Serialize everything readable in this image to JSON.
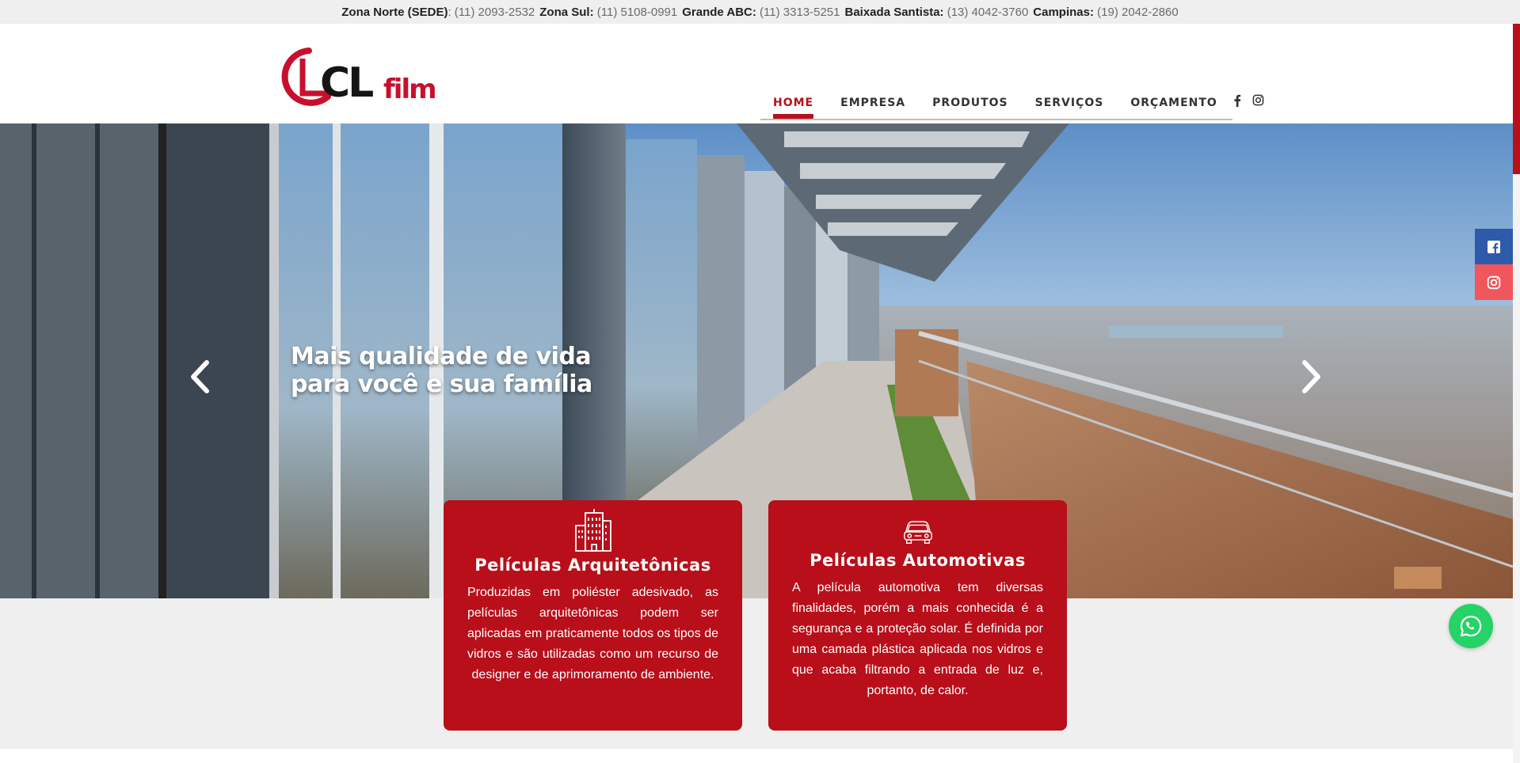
{
  "topbar": {
    "phones": [
      {
        "region": "Zona Norte (SEDE)",
        "suffix": ":",
        "number": " (11) 2093-2532"
      },
      {
        "region": "Zona Sul:",
        "suffix": "",
        "number": " (11) 5108-0991"
      },
      {
        "region": "Grande ABC:",
        "suffix": "",
        "number": " (11) 3313-5251"
      },
      {
        "region": "Baixada Santista:",
        "suffix": "",
        "number": " (13) 4042-3760"
      },
      {
        "region": "Campinas:",
        "suffix": "",
        "number": " (19) 2042-2860"
      }
    ]
  },
  "logo": {
    "brand_main": "CL",
    "brand_sub": "film"
  },
  "nav": {
    "items": [
      "HOME",
      "EMPRESA",
      "PRODUTOS",
      "SERVIÇOS",
      "ORÇAMENTO"
    ],
    "active": "HOME",
    "social": [
      "facebook-icon",
      "instagram-icon"
    ]
  },
  "hero": {
    "title_line1": "Mais qualidade de vida",
    "title_line2": "para você e sua família",
    "prev_icon": "chevron-left-icon",
    "next_icon": "chevron-right-icon"
  },
  "cards": [
    {
      "icon": "buildings-icon",
      "title": "Películas Arquitetônicas",
      "text": "Produzidas em poliéster adesivado, as películas arquitetônicas podem ser aplicadas em praticamente todos os tipos de vidros e são utilizadas como um recurso de designer e de aprimoramento de ambiente."
    },
    {
      "icon": "car-icon",
      "title": "Películas Automotivas",
      "text": "A película automotiva tem diversas finalidades, porém a mais conhecida é a segurança e a proteção solar. É definida por uma camada plástica aplicada nos vidros e que acaba filtrando a entrada de luz e, portanto, de calor."
    }
  ],
  "floating": {
    "facebook": "facebook-square-icon",
    "instagram": "instagram-icon",
    "whatsapp": "whatsapp-icon"
  },
  "colors": {
    "brand_red": "#b80f1a",
    "facebook_blue": "#2d5baa",
    "instagram_pink": "#f1565c",
    "whatsapp_green": "#25d366",
    "gray_bg": "#efefef"
  }
}
